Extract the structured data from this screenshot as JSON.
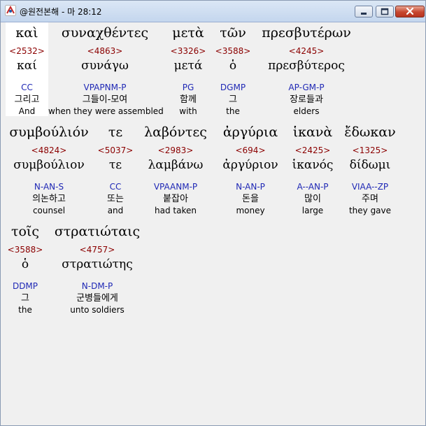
{
  "window": {
    "title": "@원전본해 - 마 28:12",
    "icon": "app-logo-icon"
  },
  "colors": {
    "strongs": "#8b0000",
    "parse": "#1f28b5",
    "highlight": "#ffffff"
  },
  "words": [
    {
      "greek": "καὶ",
      "strongs": "<2532>",
      "lemma": "καί",
      "parse": "CC",
      "korean": "그리고",
      "english": "And"
    },
    {
      "greek": "συναχθέντες",
      "strongs": "<4863>",
      "lemma": "συνάγω",
      "parse": "VPAPNM-P",
      "korean": "그들이-모여",
      "english": "when they were assembled"
    },
    {
      "greek": "μετὰ",
      "strongs": "<3326>",
      "lemma": "μετά",
      "parse": "PG",
      "korean": "함께",
      "english": "with"
    },
    {
      "greek": "τῶν",
      "strongs": "<3588>",
      "lemma": "ὁ",
      "parse": "DGMP",
      "korean": "그",
      "english": "the"
    },
    {
      "greek": "πρεσβυτέρων",
      "strongs": "<4245>",
      "lemma": "πρεσβύτερος",
      "parse": "AP-GM-P",
      "korean": "장로들과",
      "english": "elders"
    },
    {
      "greek": "συμβούλιόν",
      "strongs": "<4824>",
      "lemma": "συμβούλιον",
      "parse": "N-AN-S",
      "korean": "의논하고",
      "english": "counsel"
    },
    {
      "greek": "τε",
      "strongs": "<5037>",
      "lemma": "τε",
      "parse": "CC",
      "korean": "또는",
      "english": "and"
    },
    {
      "greek": "λαβόντες",
      "strongs": "<2983>",
      "lemma": "λαμβάνω",
      "parse": "VPAANM-P",
      "korean": "붙잡아",
      "english": "had taken"
    },
    {
      "greek": "ἀργύρια",
      "strongs": "<694>",
      "lemma": "ἀργύριον",
      "parse": "N-AN-P",
      "korean": "돈을",
      "english": "money"
    },
    {
      "greek": "ἱκανὰ",
      "strongs": "<2425>",
      "lemma": "ἱκανός",
      "parse": "A--AN-P",
      "korean": "많이",
      "english": "large"
    },
    {
      "greek": "ἔδωκαν",
      "strongs": "<1325>",
      "lemma": "δίδωμι",
      "parse": "VIAA--ZP",
      "korean": "주며",
      "english": "they gave"
    },
    {
      "greek": "τοῖς",
      "strongs": "<3588>",
      "lemma": "ὁ",
      "parse": "DDMP",
      "korean": "그",
      "english": "the"
    },
    {
      "greek": "στρατιώταις",
      "strongs": "<4757>",
      "lemma": "στρατιώτης",
      "parse": "N-DM-P",
      "korean": "군병들에게",
      "english": "unto soldiers"
    }
  ]
}
